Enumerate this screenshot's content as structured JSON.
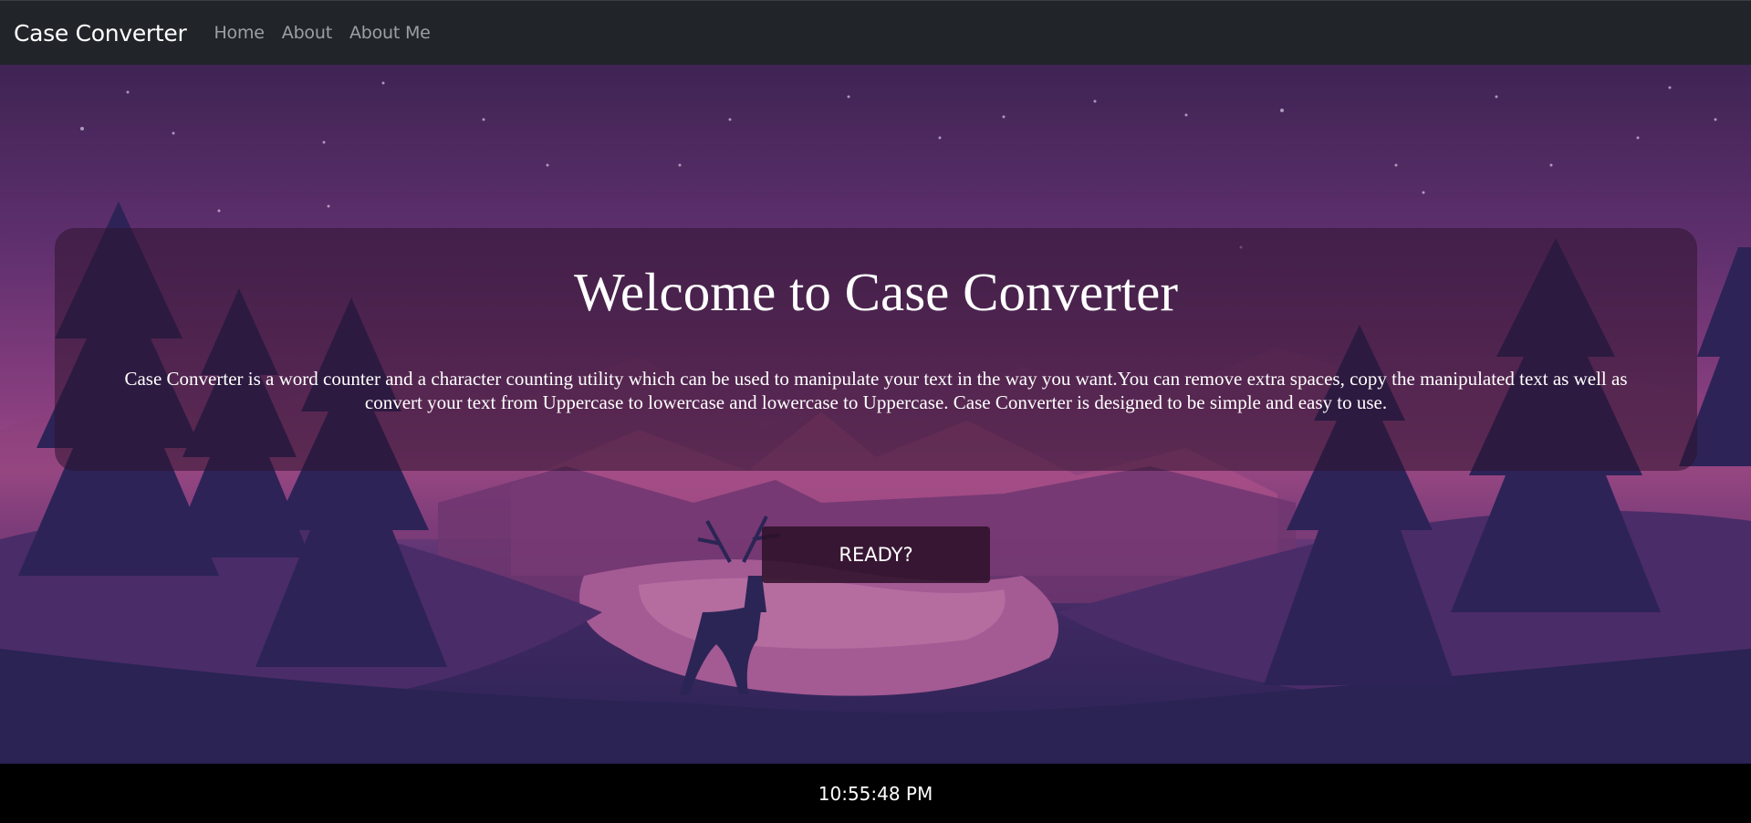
{
  "navbar": {
    "brand": "Case Converter",
    "links": [
      "Home",
      "About",
      "About Me"
    ]
  },
  "hero": {
    "title": "Welcome to Case Converter",
    "description": "Case Converter is a word counter and a character counting utility which can be used to manipulate your text in the way you want.You can remove extra spaces, copy the manipulated text as well as convert your text from Uppercase to lowercase and lowercase to Uppercase. Case Converter is designed to be simple and easy to use.",
    "button_label": "READY?"
  },
  "footer": {
    "time": "10:55:48 PM"
  },
  "colors": {
    "navbar_bg": "#212529",
    "footer_bg": "#000000",
    "sky_top": "#3f2454",
    "horizon": "#a34f8a",
    "forest": "#2a2354"
  }
}
